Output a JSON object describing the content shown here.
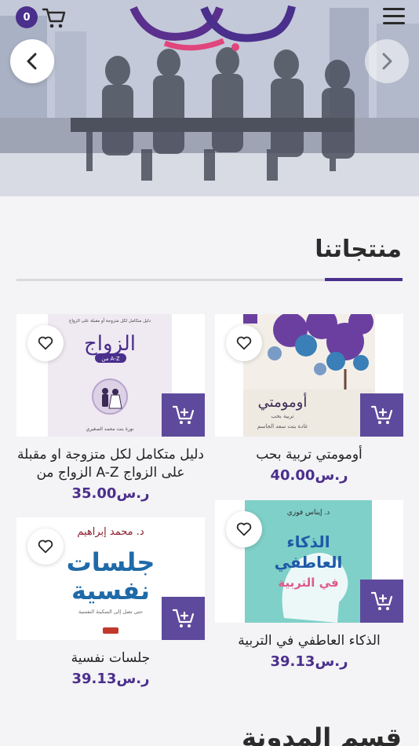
{
  "header": {
    "cart_count": "0",
    "logo_text": "نفرقها"
  },
  "hero": {
    "prev_icon": "chevron-left-icon",
    "next_icon": "chevron-right-icon"
  },
  "products_section": {
    "title": "منتجاتنا",
    "accent_color": "#4a2f8c"
  },
  "products": [
    {
      "title": "أومومتي تربية بحب",
      "price": "ر.س40.00",
      "cover_title": "أومومتي",
      "cover_subtitle": "تربية بحب",
      "cover_author": "غادة بنت سعد الجاسم"
    },
    {
      "title": "دليل متكامل لكل متزوجة او مقبلة على الزواج A-Z الزواج من",
      "price": "ر.س35.00",
      "cover_title": "الزواج",
      "cover_subtitle": "من A-Z",
      "cover_top": "دليل متكامل لكل متزوجة أو مقبلة على الزواج",
      "cover_author": "نورة بنت محمد الصغيري"
    },
    {
      "title": "الذكاء العاطفي في التربية",
      "price": "ر.س39.13",
      "cover_author": "د. إيناس فوزي",
      "cover_title_line1": "الذكاء",
      "cover_title_line2": "العاطفي",
      "cover_title_line3": "في التربية"
    },
    {
      "title": "جلسات نفسية",
      "price": "ر.س39.13",
      "cover_author": "د. محمد إبراهيم",
      "cover_title_line1": "جلسات",
      "cover_title_line2": "نفسية",
      "cover_subtitle": "حتى تصل إلى السكينة النفسية"
    }
  ],
  "blog_section": {
    "title": "قسم المدونة"
  }
}
